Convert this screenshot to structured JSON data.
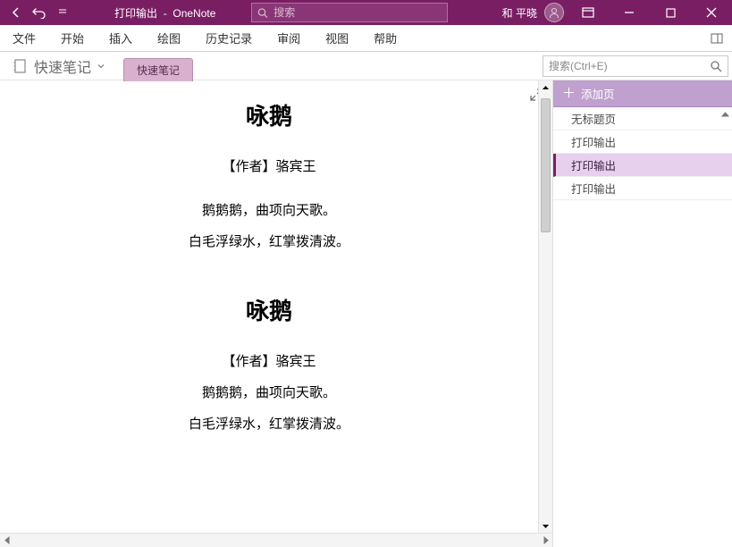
{
  "titlebar": {
    "doc_title": "打印输出",
    "app_name": "OneNote",
    "search_placeholder": "搜索",
    "user_name": "和 平晓"
  },
  "ribbon": {
    "tabs": [
      "文件",
      "开始",
      "插入",
      "绘图",
      "历史记录",
      "审阅",
      "视图",
      "帮助"
    ]
  },
  "notebook": {
    "name": "快速笔记",
    "section_tab": "快速笔记",
    "page_search_placeholder": "搜索(Ctrl+E)"
  },
  "page_panel": {
    "add_label": "添加页",
    "items": [
      {
        "label": "无标题页",
        "selected": false
      },
      {
        "label": "打印输出",
        "selected": false
      },
      {
        "label": "打印输出",
        "selected": true
      },
      {
        "label": "打印输出",
        "selected": false
      }
    ]
  },
  "content": {
    "poems": [
      {
        "title": "咏鹅",
        "author": "【作者】骆宾王",
        "lines": [
          "鹅鹅鹅，曲项向天歌。",
          "白毛浮绿水，红掌拨清波。"
        ]
      },
      {
        "title": "咏鹅",
        "author": "【作者】骆宾王",
        "lines": [
          "鹅鹅鹅，曲项向天歌。",
          "白毛浮绿水，红掌拨清波。"
        ]
      }
    ]
  }
}
